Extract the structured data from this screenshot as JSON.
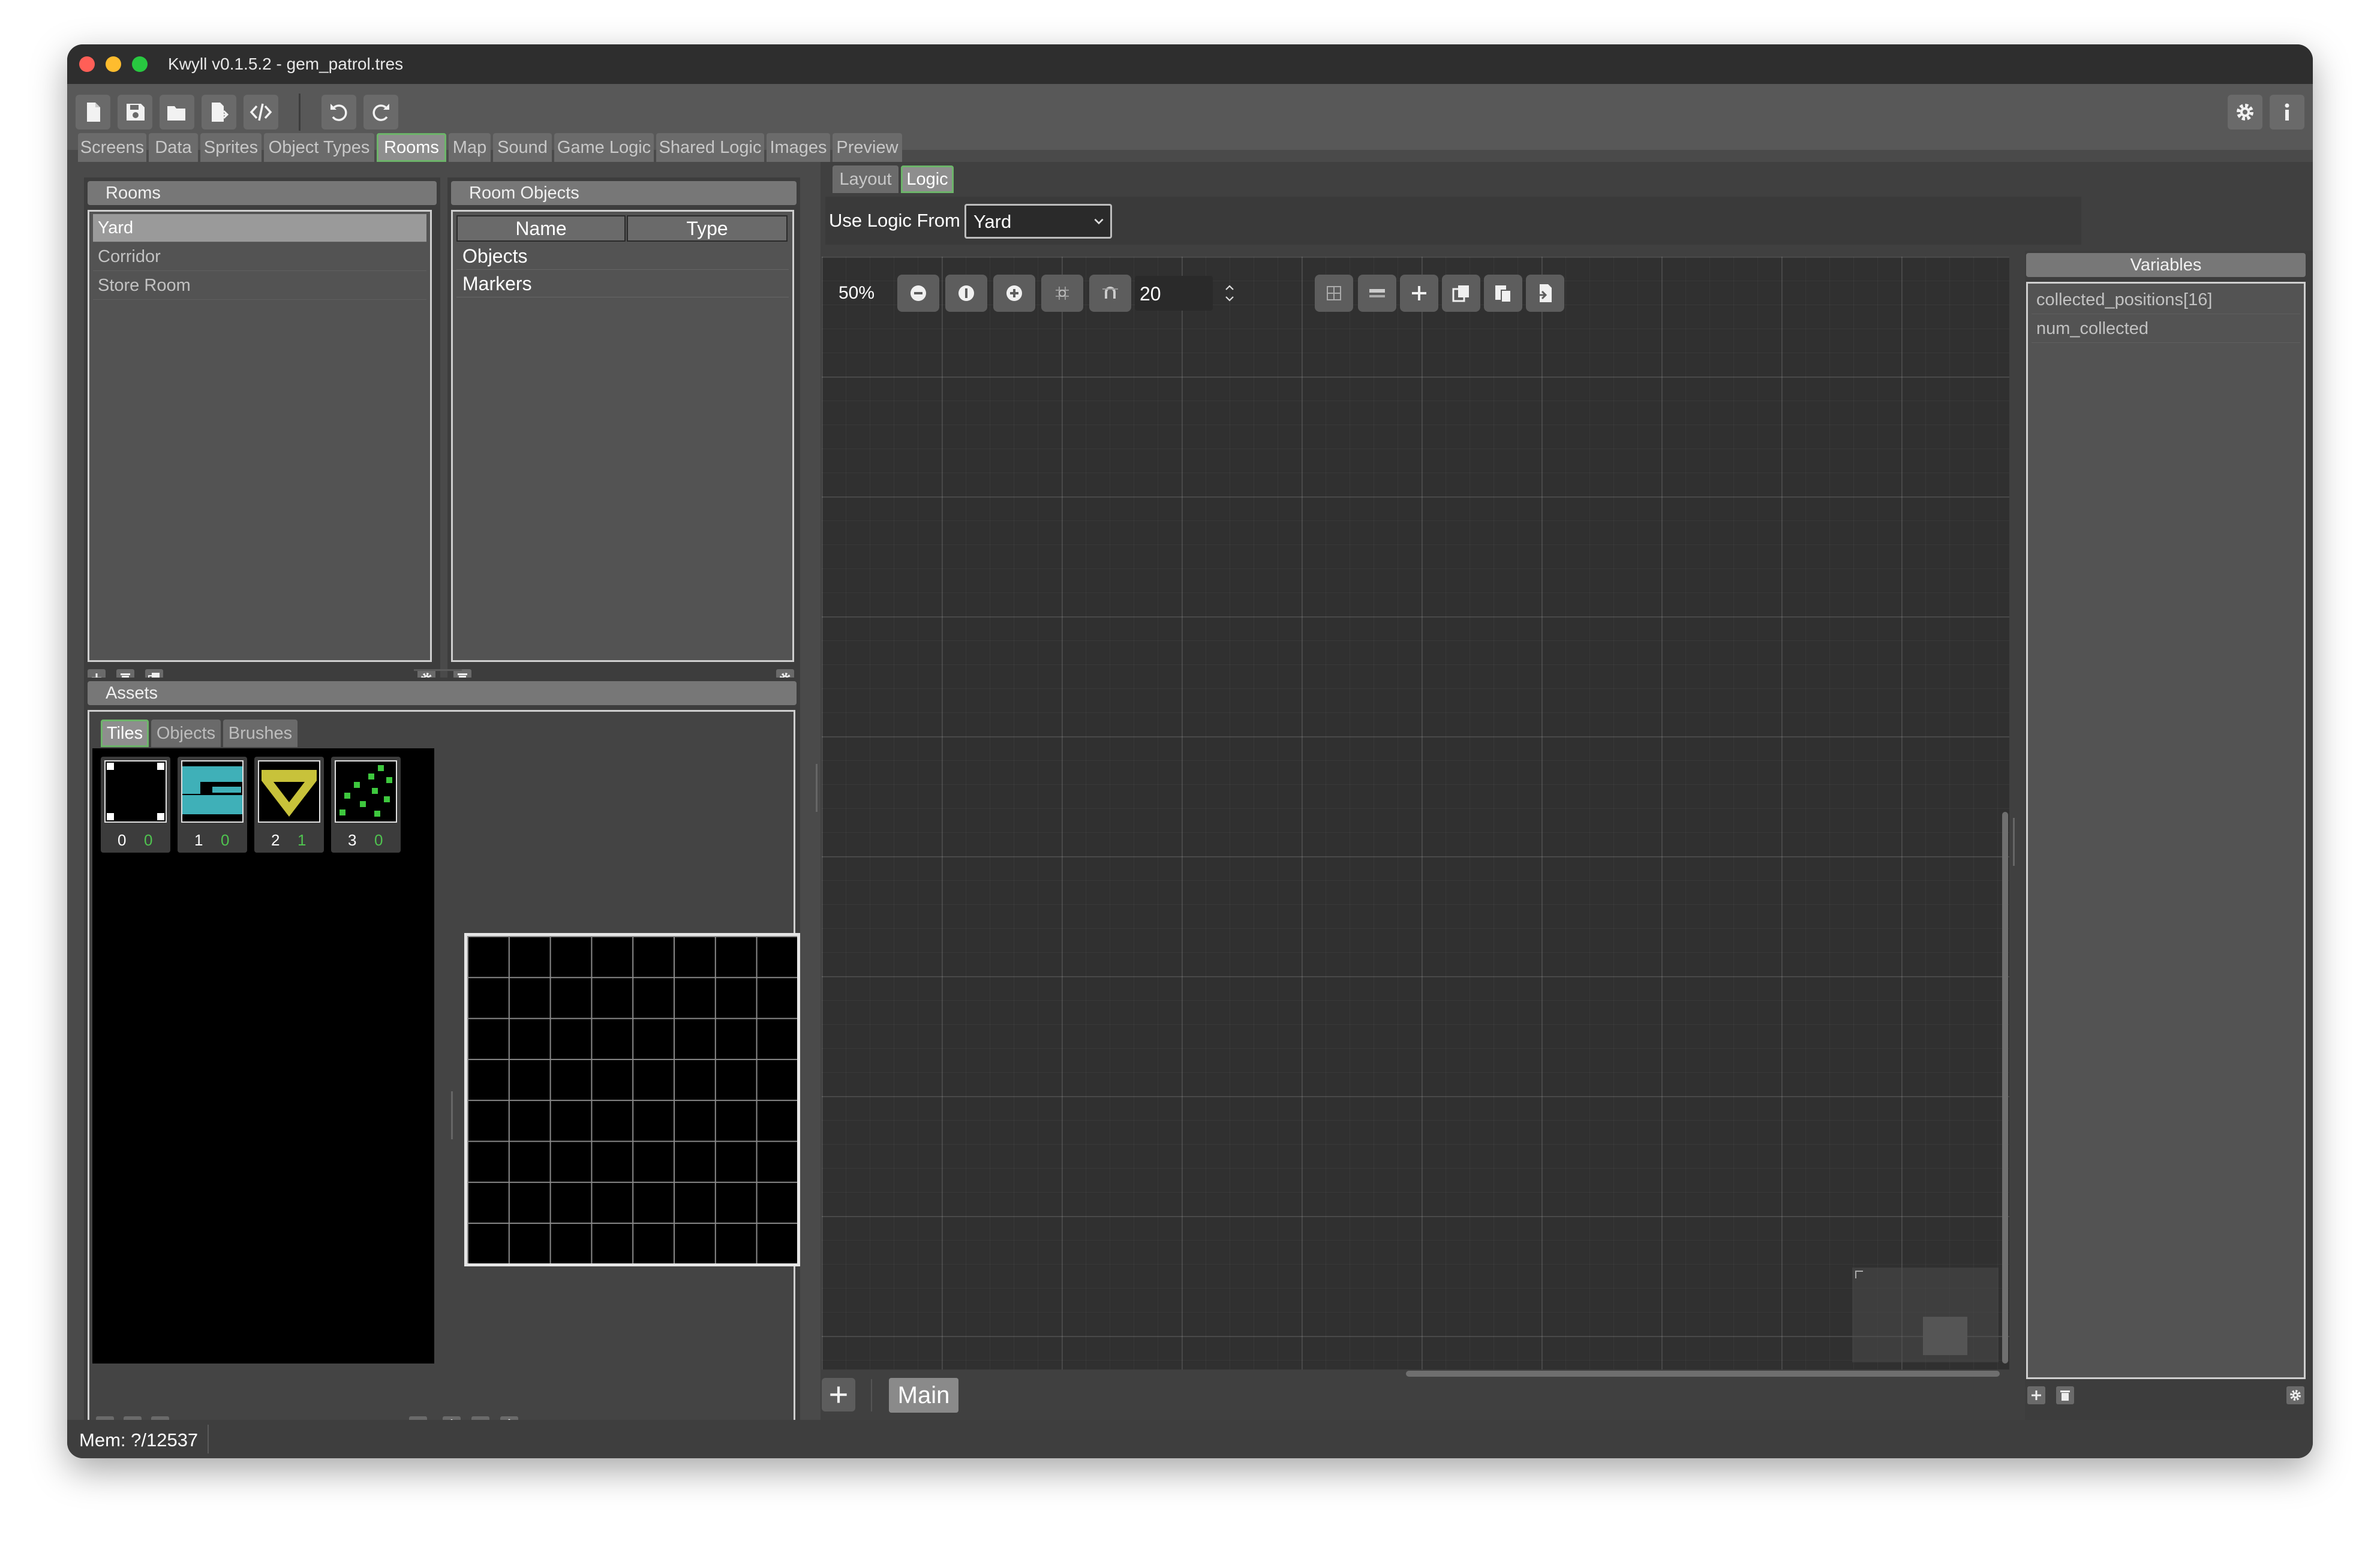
{
  "window": {
    "title": "Kwyll v0.1.5.2 - gem_patrol.tres"
  },
  "toolbar": {
    "icons": [
      "new-file-icon",
      "save-icon",
      "open-folder-icon",
      "export-icon",
      "code-icon",
      "undo-icon",
      "redo-icon",
      "settings-icon",
      "info-icon"
    ]
  },
  "main_tabs": [
    {
      "label": "Screens"
    },
    {
      "label": "Data"
    },
    {
      "label": "Sprites"
    },
    {
      "label": "Object Types"
    },
    {
      "label": "Rooms"
    },
    {
      "label": "Map"
    },
    {
      "label": "Sound"
    },
    {
      "label": "Game Logic"
    },
    {
      "label": "Shared Logic"
    },
    {
      "label": "Images"
    },
    {
      "label": "Preview"
    }
  ],
  "active_tab": "Rooms",
  "rooms_panel": {
    "title": "Rooms",
    "items": [
      "Yard",
      "Corridor",
      "Store Room"
    ],
    "selected": "Yard"
  },
  "room_objects_panel": {
    "title": "Room Objects",
    "columns": [
      "Name",
      "Type"
    ],
    "rows": [
      "Objects",
      "Markers"
    ]
  },
  "assets_panel": {
    "title": "Assets",
    "tabs": [
      "Tiles",
      "Objects",
      "Brushes"
    ],
    "active_tab": "Tiles",
    "tiles": [
      {
        "index": "0",
        "count": "0"
      },
      {
        "index": "1",
        "count": "0"
      },
      {
        "index": "2",
        "count": "1"
      },
      {
        "index": "3",
        "count": "0"
      }
    ]
  },
  "editor": {
    "subtabs": [
      "Layout",
      "Logic"
    ],
    "active_subtab": "Logic",
    "use_logic_label": "Use Logic From",
    "use_logic_value": "Yard",
    "zoom": "50%",
    "snap_value": "20",
    "bottom_tab": "Main"
  },
  "variables_panel": {
    "title": "Variables",
    "items": [
      "collected_positions[16]",
      "num_collected"
    ]
  },
  "status_bar": {
    "memory": "Mem: ?/12537"
  },
  "colors": {
    "accent_green": "#6db46a",
    "tile_cyan": "#3fb0b8",
    "tile_yellow": "#c8c23a",
    "tile_green": "#3ec83e"
  }
}
